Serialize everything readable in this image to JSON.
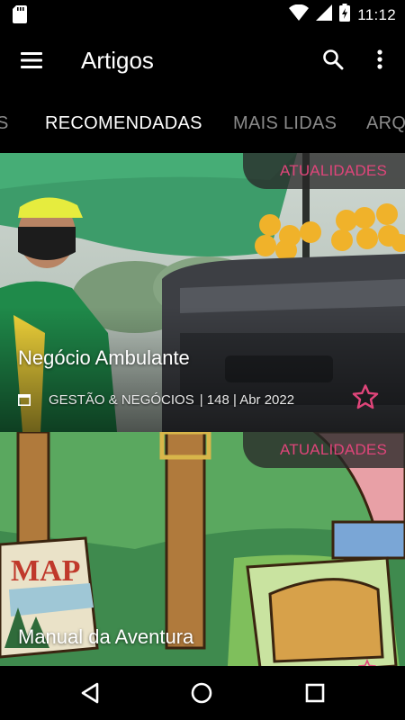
{
  "status_bar": {
    "time": "11:12",
    "icons": [
      "sd-card-icon",
      "wifi-icon",
      "signal-icon",
      "battery-charging-icon"
    ]
  },
  "app_bar": {
    "title": "Artigos",
    "icons": [
      "menu-icon",
      "search-icon",
      "more-vert-icon"
    ]
  },
  "tabs": [
    {
      "label": "S",
      "active": false
    },
    {
      "label": "RECOMENDADAS",
      "active": true
    },
    {
      "label": "MAIS LIDAS",
      "active": false
    },
    {
      "label": "ARQ",
      "active": false
    }
  ],
  "articles": [
    {
      "badge": "ATUALIDADES",
      "title": "Negócio Ambulante",
      "category": "GESTÃO & NEGÓCIOS",
      "issue_date": "| 148 | Abr 2022",
      "favorite_icon": "star-outline-icon"
    },
    {
      "badge": "ATUALIDADES",
      "title": "Manual da Aventura",
      "map_text": "MAP"
    }
  ],
  "colors": {
    "accent": "#e0457a",
    "background": "#000000",
    "tab_inactive": "#8a8a8a"
  },
  "nav_bar": {
    "icons": [
      "back-icon",
      "home-icon",
      "recents-icon"
    ]
  }
}
